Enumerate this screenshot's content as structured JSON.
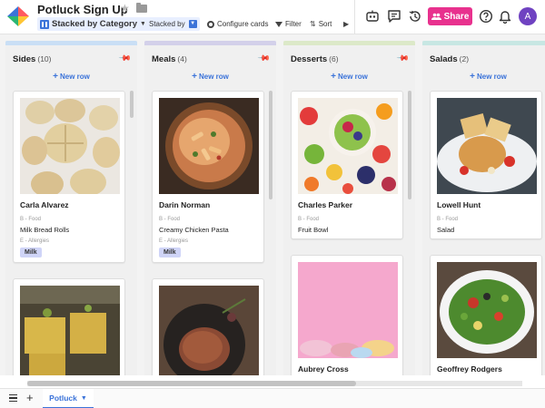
{
  "app": {
    "title": "Potluck Sign Up",
    "view_name": "Stacked by Category",
    "stacked_by_label": "Stacked by",
    "configure_label": "Configure cards",
    "filter_label": "Filter",
    "sort_label": "Sort",
    "share_label": "Share",
    "avatar_initial": "A"
  },
  "colors": {
    "accent": "#3b73d9",
    "share": "#e8318e",
    "avatar": "#6f42c1",
    "tag": "#cfd4f7"
  },
  "board": {
    "new_row_label": "New row",
    "field_food": "B - Food",
    "field_allergies": "E - Allergies",
    "columns": [
      {
        "name": "Sides",
        "count": "(10)",
        "bar_color": "#c9dff5",
        "cards": [
          {
            "name": "Carla Alvarez",
            "food": "Milk Bread Rolls",
            "tag": "Milk"
          },
          {
            "name": "",
            "food": "",
            "tag": ""
          }
        ]
      },
      {
        "name": "Meals",
        "count": "(4)",
        "bar_color": "#d3d0ea",
        "cards": [
          {
            "name": "Darin Norman",
            "food": "Creamy Chicken Pasta",
            "tag": "Milk"
          },
          {
            "name": "",
            "food": "",
            "tag": ""
          }
        ]
      },
      {
        "name": "Desserts",
        "count": "(6)",
        "bar_color": "#dce9c8",
        "cards": [
          {
            "name": "Charles Parker",
            "food": "Fruit Bowl",
            "tag": ""
          },
          {
            "name": "Aubrey Cross",
            "food": "",
            "tag": ""
          }
        ]
      },
      {
        "name": "Salads",
        "count": "(2)",
        "bar_color": "#c7e7e3",
        "cards": [
          {
            "name": "Lowell Hunt",
            "food": "Salad",
            "tag": ""
          },
          {
            "name": "Geoffrey Rodgers",
            "food": "",
            "tag": ""
          }
        ]
      }
    ]
  },
  "footer": {
    "tab_label": "Potluck"
  }
}
